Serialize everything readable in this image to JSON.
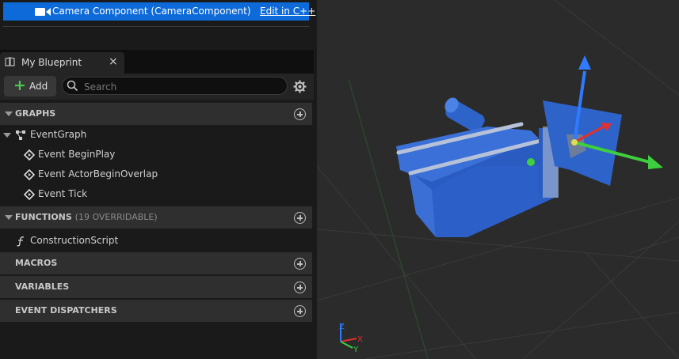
{
  "components": {
    "selected_name": "Camera Component (CameraComponent)",
    "edit_link": "Edit in C++"
  },
  "tab": {
    "label": "My Blueprint",
    "close": "×"
  },
  "toolbar": {
    "add_label": "Add",
    "search_placeholder": "Search"
  },
  "sections": {
    "graphs": {
      "title": "GRAPHS"
    },
    "functions": {
      "title": "FUNCTIONS",
      "extra": "(19 OVERRIDABLE)"
    },
    "macros": {
      "title": "MACROS"
    },
    "variables": {
      "title": "VARIABLES"
    },
    "dispatchers": {
      "title": "EVENT DISPATCHERS"
    }
  },
  "graph_items": {
    "event_graph": "EventGraph",
    "events": [
      "Event BeginPlay",
      "Event ActorBeginOverlap",
      "Event Tick"
    ]
  },
  "function_items": [
    "ConstructionScript"
  ],
  "viewport": {
    "axis_labels": {
      "x": "X",
      "y": "Y",
      "z": "Z"
    },
    "colors": {
      "camera_body": "#2e63c9",
      "x_axis": "#e03030",
      "y_axis": "#3ecf3e",
      "z_axis": "#2f7bff"
    }
  }
}
